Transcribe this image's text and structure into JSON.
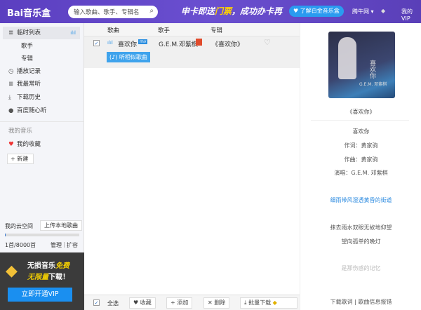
{
  "header": {
    "logo": "Bai音乐盒",
    "search_placeholder": "输入歌曲、歌手、专辑名",
    "banner_a": "申卡即送",
    "banner_b": "门票",
    "banner_c": "，成功办卡再",
    "promo": "了解白金音乐盒",
    "site": "腾牛网",
    "my_vip": "我的VIP"
  },
  "sidebar": {
    "items": [
      {
        "label": "临时列表"
      },
      {
        "label": "歌手"
      },
      {
        "label": "专辑"
      },
      {
        "label": "播放记录"
      },
      {
        "label": "我最常听"
      },
      {
        "label": "下载历史"
      },
      {
        "label": "百度随心听"
      }
    ],
    "my_music": "我的音乐",
    "favorites": "我的收藏",
    "new": "新建",
    "cloud": {
      "title": "我的云空间",
      "upload": "上传本地歌曲",
      "usage": "1首/8000首",
      "usage_fraction": 0.000125,
      "manage": "管理",
      "expand": "扩容"
    },
    "vip": {
      "line1a": "无损音乐",
      "line1b": "免费",
      "line2a": "无限量",
      "line2b": "下载！",
      "button": "立即开通VIP"
    }
  },
  "list": {
    "columns": [
      "歌曲",
      "歌手",
      "专辑"
    ],
    "rows": [
      {
        "song": "喜欢你",
        "mv": "mv",
        "artist": "G.E.M.邓紫棋",
        "album": "《喜欢你》",
        "checked": true
      }
    ],
    "similar": "听相似歌曲"
  },
  "footer": {
    "select_all": "全选",
    "favorite": "收藏",
    "add": "添加",
    "delete": "删除",
    "batch_download": "批量下载"
  },
  "right": {
    "album": "《喜欢你》",
    "cover_title": "喜欢你",
    "cover_artist": "G.E.M. 邓紫棋",
    "lyrics": [
      "喜欢你",
      "作词：黄家驹",
      "作曲：黄家驹",
      "演唱：G.E.M. 邓紫棋",
      "细雨带风湿透黄昏的街道",
      "抹去雨水双眼无故地仰望",
      "望向孤单的晚灯",
      "是那伤感的记忆"
    ],
    "download_lyrics": "下载歌词",
    "report": "歌曲信息报错"
  }
}
